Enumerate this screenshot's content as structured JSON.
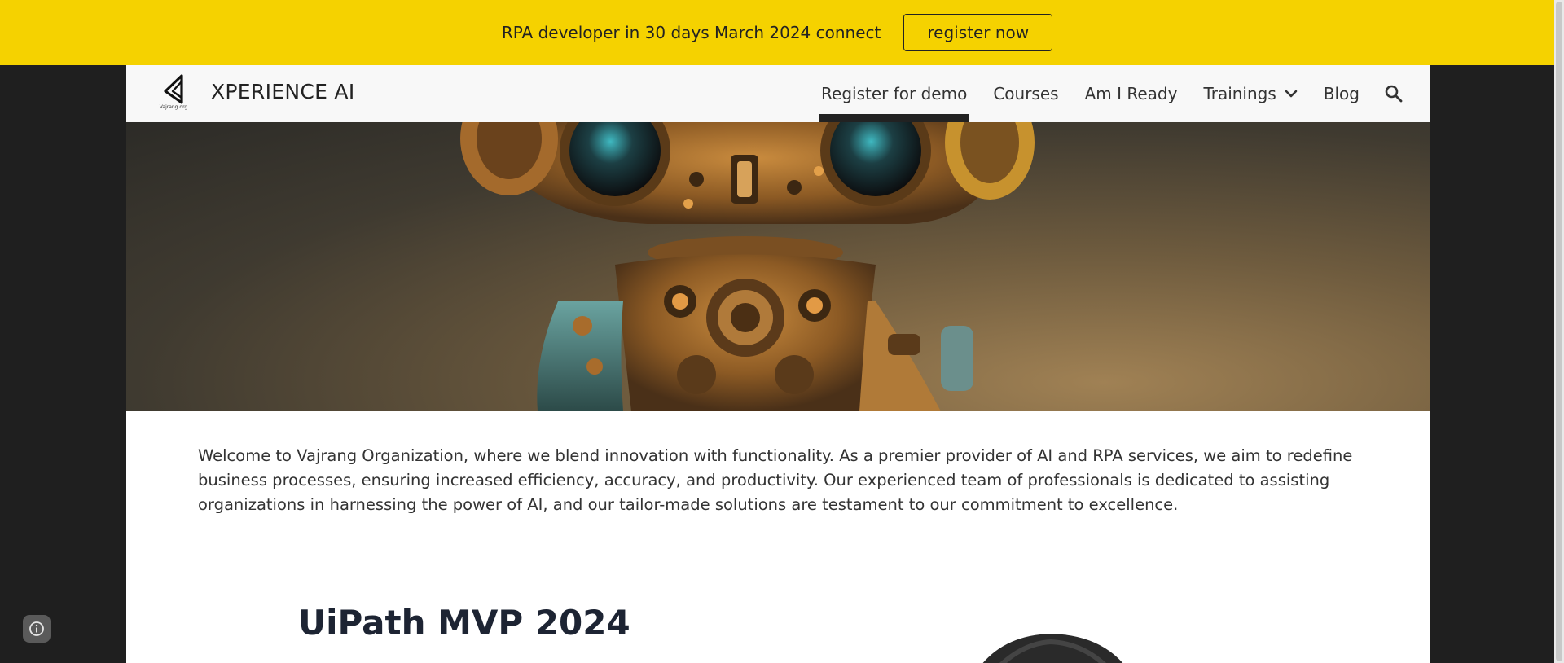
{
  "announcement": {
    "text": "RPA developer in 30 days March 2024 connect",
    "button_label": "register now"
  },
  "header": {
    "site_title": "XPERIENCE AI",
    "logo_caption": "Vajrang.org",
    "nav": [
      {
        "label": "Register for demo",
        "active": true
      },
      {
        "label": "Courses"
      },
      {
        "label": "Am I Ready"
      },
      {
        "label": "Trainings",
        "has_dropdown": true
      },
      {
        "label": "Blog"
      }
    ],
    "icons": [
      "search-icon",
      "chevron-down-icon"
    ]
  },
  "hero": {
    "image": "robot-illustration"
  },
  "main": {
    "intro": "Welcome to Vajrang Organization, where we blend innovation with functionality. As a premier provider of AI and RPA services, we aim to redefine business processes, ensuring increased efficiency, accuracy, and productivity. Our experienced team of professionals is dedicated to assisting organizations in harnessing the power of AI, and our tailor-made solutions are testament to our commitment to excellence.",
    "section_title": "UiPath MVP 2024"
  },
  "colors": {
    "announcement_bg": "#f5d200",
    "nav_bg": "#f8f8f8",
    "page_bg": "#1f1f1f"
  }
}
